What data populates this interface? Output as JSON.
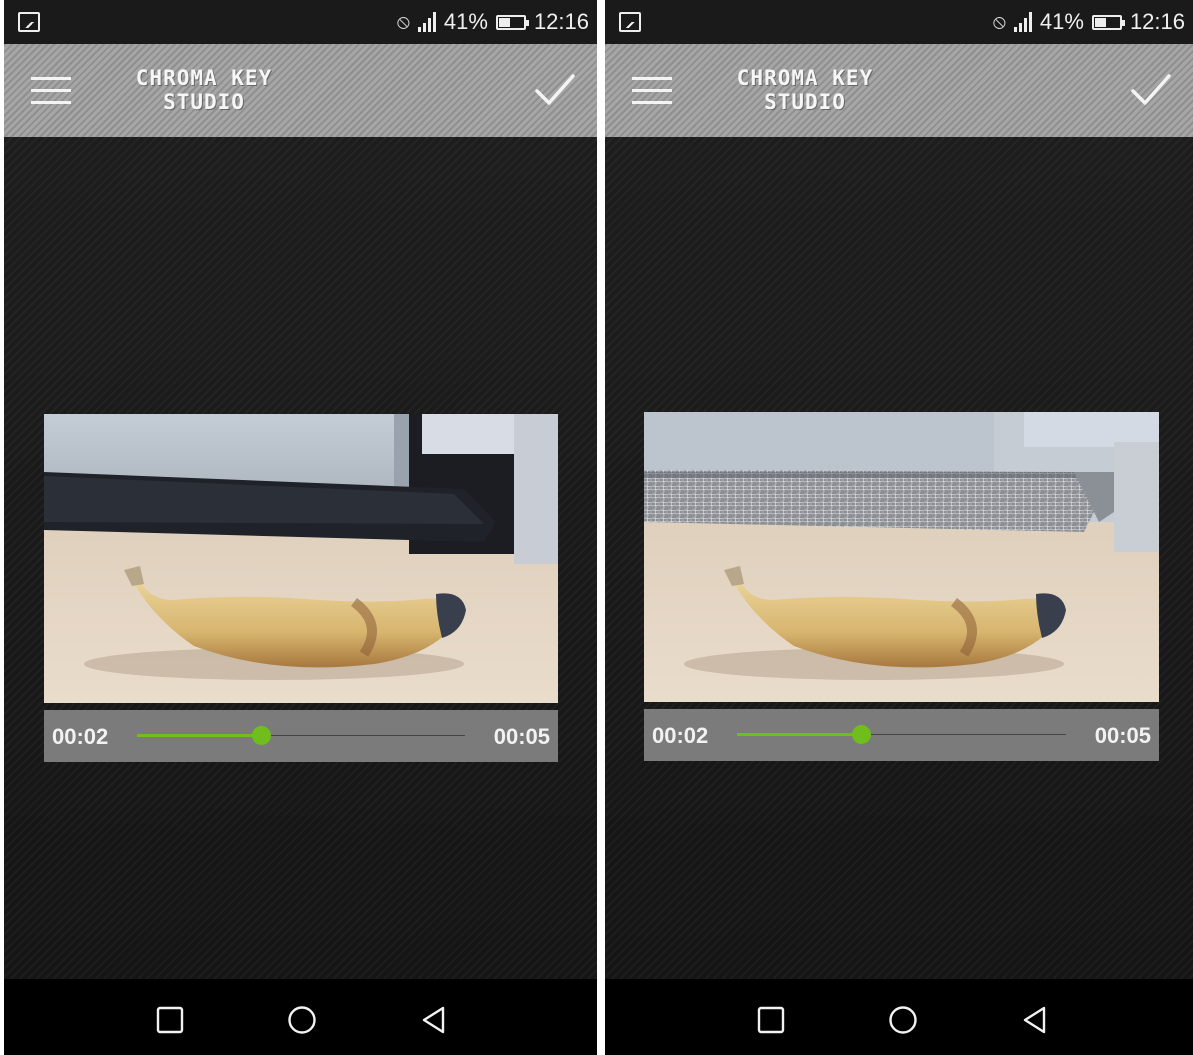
{
  "screens": [
    {
      "status": {
        "battery": "41%",
        "battery_level": 0.41,
        "time": "12:16"
      },
      "app": {
        "title_line1": "CHROMA KEY",
        "title_line2": "STUDIO"
      },
      "player": {
        "current_time": "00:02",
        "total_time": "00:05",
        "progress": 0.38
      }
    },
    {
      "status": {
        "battery": "41%",
        "battery_level": 0.41,
        "time": "12:16"
      },
      "app": {
        "title_line1": "CHROMA KEY",
        "title_line2": "STUDIO"
      },
      "player": {
        "current_time": "00:02",
        "total_time": "00:05",
        "progress": 0.38
      }
    }
  ],
  "icons": {
    "menu": "hamburger-icon",
    "confirm": "checkmark-icon",
    "recents": "square-icon",
    "home": "circle-icon",
    "back": "triangle-back-icon"
  },
  "colors": {
    "accent": "#6fbe1c",
    "appbar": "#9a9a9a",
    "controls": "#7b7b7b"
  }
}
